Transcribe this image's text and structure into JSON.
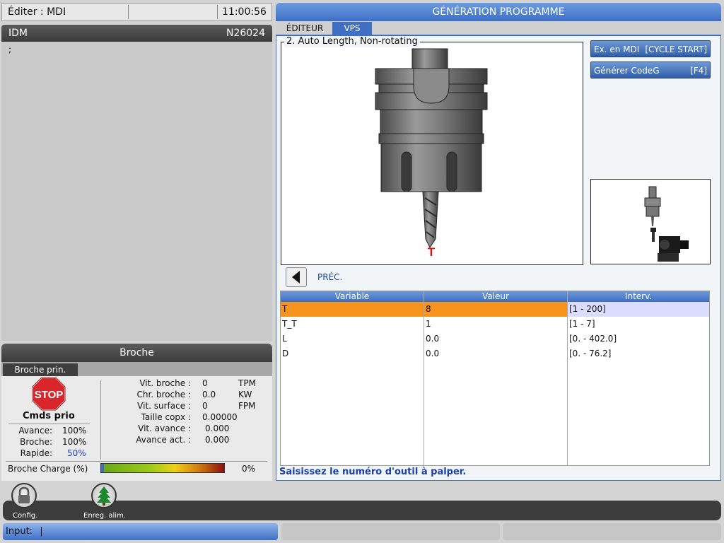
{
  "top_bar": {
    "mode": "Éditer : MDI",
    "time": "11:00:56"
  },
  "idm": {
    "title": "IDM",
    "program": "N26024",
    "cursor_text": ";"
  },
  "broche": {
    "title": "Broche",
    "tab": "Broche prin.",
    "stop_label": "STOP",
    "cmds_prio": "Cmds prio",
    "overrides": [
      {
        "label": "Avance:",
        "value": "100%"
      },
      {
        "label": "Broche:",
        "value": "100%"
      },
      {
        "label": "Rapide:",
        "value": "50%"
      }
    ],
    "stats": [
      {
        "label": "Vit. broche :",
        "value": "0",
        "unit": "TPM"
      },
      {
        "label": "Chr. broche :",
        "value": "0.0",
        "unit": "KW"
      },
      {
        "label": "Vit. surface :",
        "value": "0",
        "unit": "FPM"
      },
      {
        "label": "Taille copx :",
        "value": "0.00000",
        "unit": ""
      },
      {
        "label": "Vit. avance :",
        "value": "0.000",
        "unit": ""
      },
      {
        "label": "Avance act. :",
        "value": "0.000",
        "unit": ""
      }
    ],
    "charge_label": "Broche Charge (%)",
    "charge_value": "0%",
    "charge_fraction": 0
  },
  "program_gen": {
    "title": "GÉNÉRATION PROGRAMME",
    "tabs": [
      "ÉDITEUR",
      "VPS"
    ],
    "active_tab": 1,
    "image_caption": "2. Auto Length, Non-rotating",
    "tool_letter": "T",
    "buttons": [
      {
        "label": "Ex. en MDI",
        "key": "[CYCLE START]"
      },
      {
        "label": "Générer CodeG",
        "key": "[F4]"
      }
    ],
    "prev_label": "PRÉC.",
    "table": {
      "headers": [
        "Variable",
        "Valeur",
        "Interv."
      ],
      "rows": [
        [
          "T",
          "8",
          "[1 - 200]"
        ],
        [
          "T_T",
          "1",
          "[1 - 7]"
        ],
        [
          "L",
          "0.0",
          "[0. - 402.0]"
        ],
        [
          "D",
          "0.0",
          "[0. - 76.2]"
        ]
      ],
      "selected_row": 0
    },
    "status_message": "Saisissez le numéro d'outil à palper."
  },
  "bottom": {
    "config_label": "Config.",
    "enreg_label": "Enreg. alim.",
    "input_label": "Input:",
    "input_value": "|"
  },
  "colors": {
    "accent_blue": "#3f6fc4",
    "selected_orange": "#f7941d",
    "selected_range": "#dcdcff",
    "stop_red": "#d9262c",
    "rapid_blue": "#1a3fd0"
  }
}
